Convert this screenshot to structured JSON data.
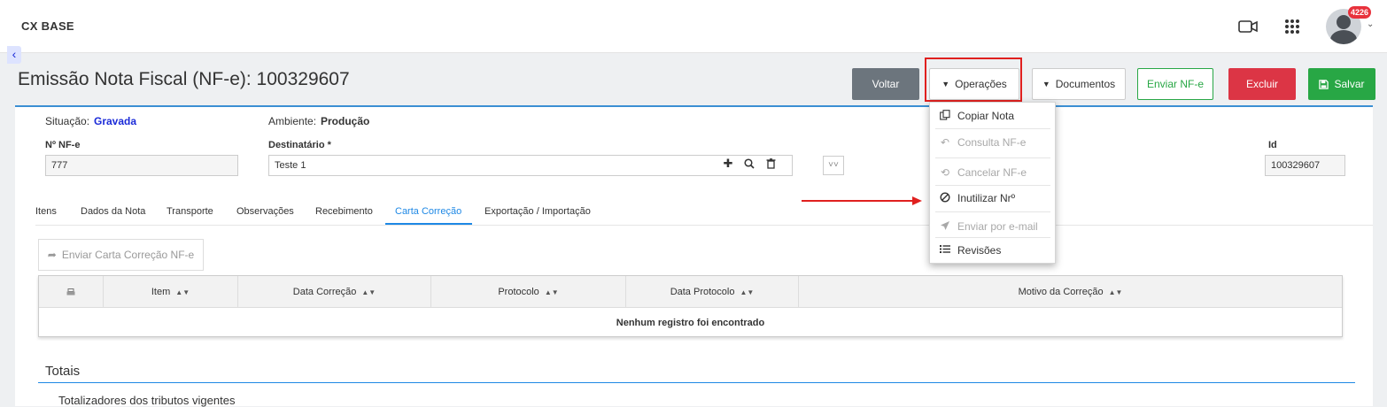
{
  "app": {
    "brand": "CX BASE",
    "notifications": "4226"
  },
  "page": {
    "title": "Emissão Nota Fiscal (NF-e): 100329607"
  },
  "toolbar": {
    "voltar": "Voltar",
    "operacoes": "Operações",
    "documentos": "Documentos",
    "enviar": "Enviar NF-e",
    "excluir": "Excluir",
    "salvar": "Salvar"
  },
  "status": {
    "situacao_label": "Situação:",
    "situacao_value": "Gravada",
    "ambiente_label": "Ambiente:",
    "ambiente_value": "Produção"
  },
  "fields": {
    "nf_label": "Nº NF-e",
    "nf_value": "777",
    "dest_label": "Destinatário *",
    "dest_value": "Teste 1",
    "id_label": "Id",
    "id_value": "100329607"
  },
  "tabs": [
    "Itens",
    "Dados da Nota",
    "Transporte",
    "Observações",
    "Recebimento",
    "Carta Correção",
    "Exportação / Importação"
  ],
  "active_tab": "Carta Correção",
  "carta": {
    "send_button": "Enviar Carta Correção NF-e",
    "columns": [
      "Item",
      "Data Correção",
      "Protocolo",
      "Data Protocolo",
      "Motivo da Correção"
    ],
    "empty": "Nenhum registro foi encontrado"
  },
  "totais": {
    "title": "Totais",
    "subtitle": "Totalizadores dos tributos vigentes"
  },
  "operacoes_menu": [
    {
      "label": "Copiar Nota",
      "icon": "copy-icon",
      "disabled": false
    },
    {
      "label": "Consulta NF-e",
      "icon": "reply-icon",
      "disabled": true
    },
    {
      "label": "Cancelar NF-e",
      "icon": "refresh-icon",
      "disabled": true
    },
    {
      "label": "Inutilizar Nrº",
      "icon": "ban-icon",
      "disabled": false
    },
    {
      "label": "Enviar por e-mail",
      "icon": "send-icon",
      "disabled": true
    },
    {
      "label": "Revisões",
      "icon": "list-icon",
      "disabled": false
    }
  ],
  "colors": {
    "primary": "#1e88e5",
    "danger": "#dc3545",
    "success": "#28a745",
    "highlight": "#e0201f"
  }
}
